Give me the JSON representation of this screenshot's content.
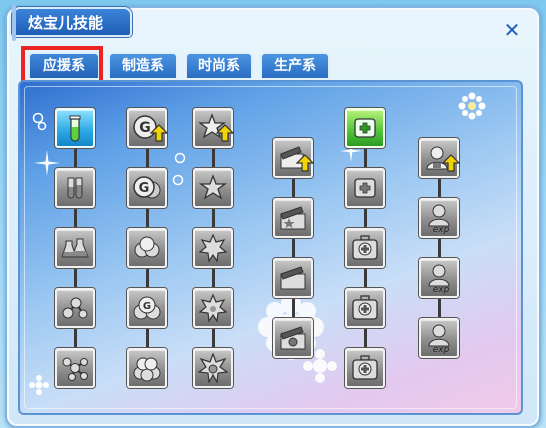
{
  "window": {
    "title": "炫宝儿技能",
    "close_glyph": "✕"
  },
  "tabs": [
    {
      "label": "应援系",
      "selected": true
    },
    {
      "label": "制造系",
      "selected": false
    },
    {
      "label": "时尚系",
      "selected": false
    },
    {
      "label": "生产系",
      "selected": false
    }
  ],
  "columns": [
    {
      "name": "test-tube",
      "skills": [
        "test-tube-icon-lv1",
        "test-tubes-icon-lv2",
        "flasks-icon-lv3",
        "molecule-icon-lv4",
        "molecule-icon-lv5"
      ],
      "first_has_upgrade": false
    },
    {
      "name": "g-coin",
      "skills": [
        "g-coin-icon-lv1",
        "g-coin-icon-lv2",
        "coins-icon-lv3",
        "coins-icon-lv4",
        "coins-icon-lv5"
      ],
      "first_has_upgrade": true
    },
    {
      "name": "star-badge",
      "skills": [
        "star-badge-icon-lv1",
        "star-badge-icon-lv2",
        "star-badge-icon-lv3",
        "star-badge-icon-lv4",
        "star-badge-icon-lv5"
      ],
      "first_has_upgrade": true
    },
    {
      "name": "clapperboard",
      "skills": [
        "clapperboard-icon-lv1",
        "clapperboard-star-icon-lv2",
        "clapperboard-moon-icon-lv3",
        "clapperboard-camera-icon-lv4"
      ],
      "first_has_upgrade": true
    },
    {
      "name": "medkit",
      "skills": [
        "medkit-icon-lv1",
        "medkit-icon-lv2",
        "medkit-icon-lv3",
        "medkit-icon-lv4",
        "medkit-icon-lv5"
      ],
      "first_has_upgrade": false
    },
    {
      "name": "exp-person",
      "skills": [
        "person-icon-lv1",
        "exp-person-icon-lv2",
        "exp-person-icon-lv3",
        "exp-person-icon-lv4"
      ],
      "first_has_upgrade": true
    }
  ],
  "exp_label": "exp",
  "colors": {
    "tab_blue": "#2a6dc4",
    "highlight_red": "#ec2424",
    "upgrade_arrow": "#f2d400"
  }
}
